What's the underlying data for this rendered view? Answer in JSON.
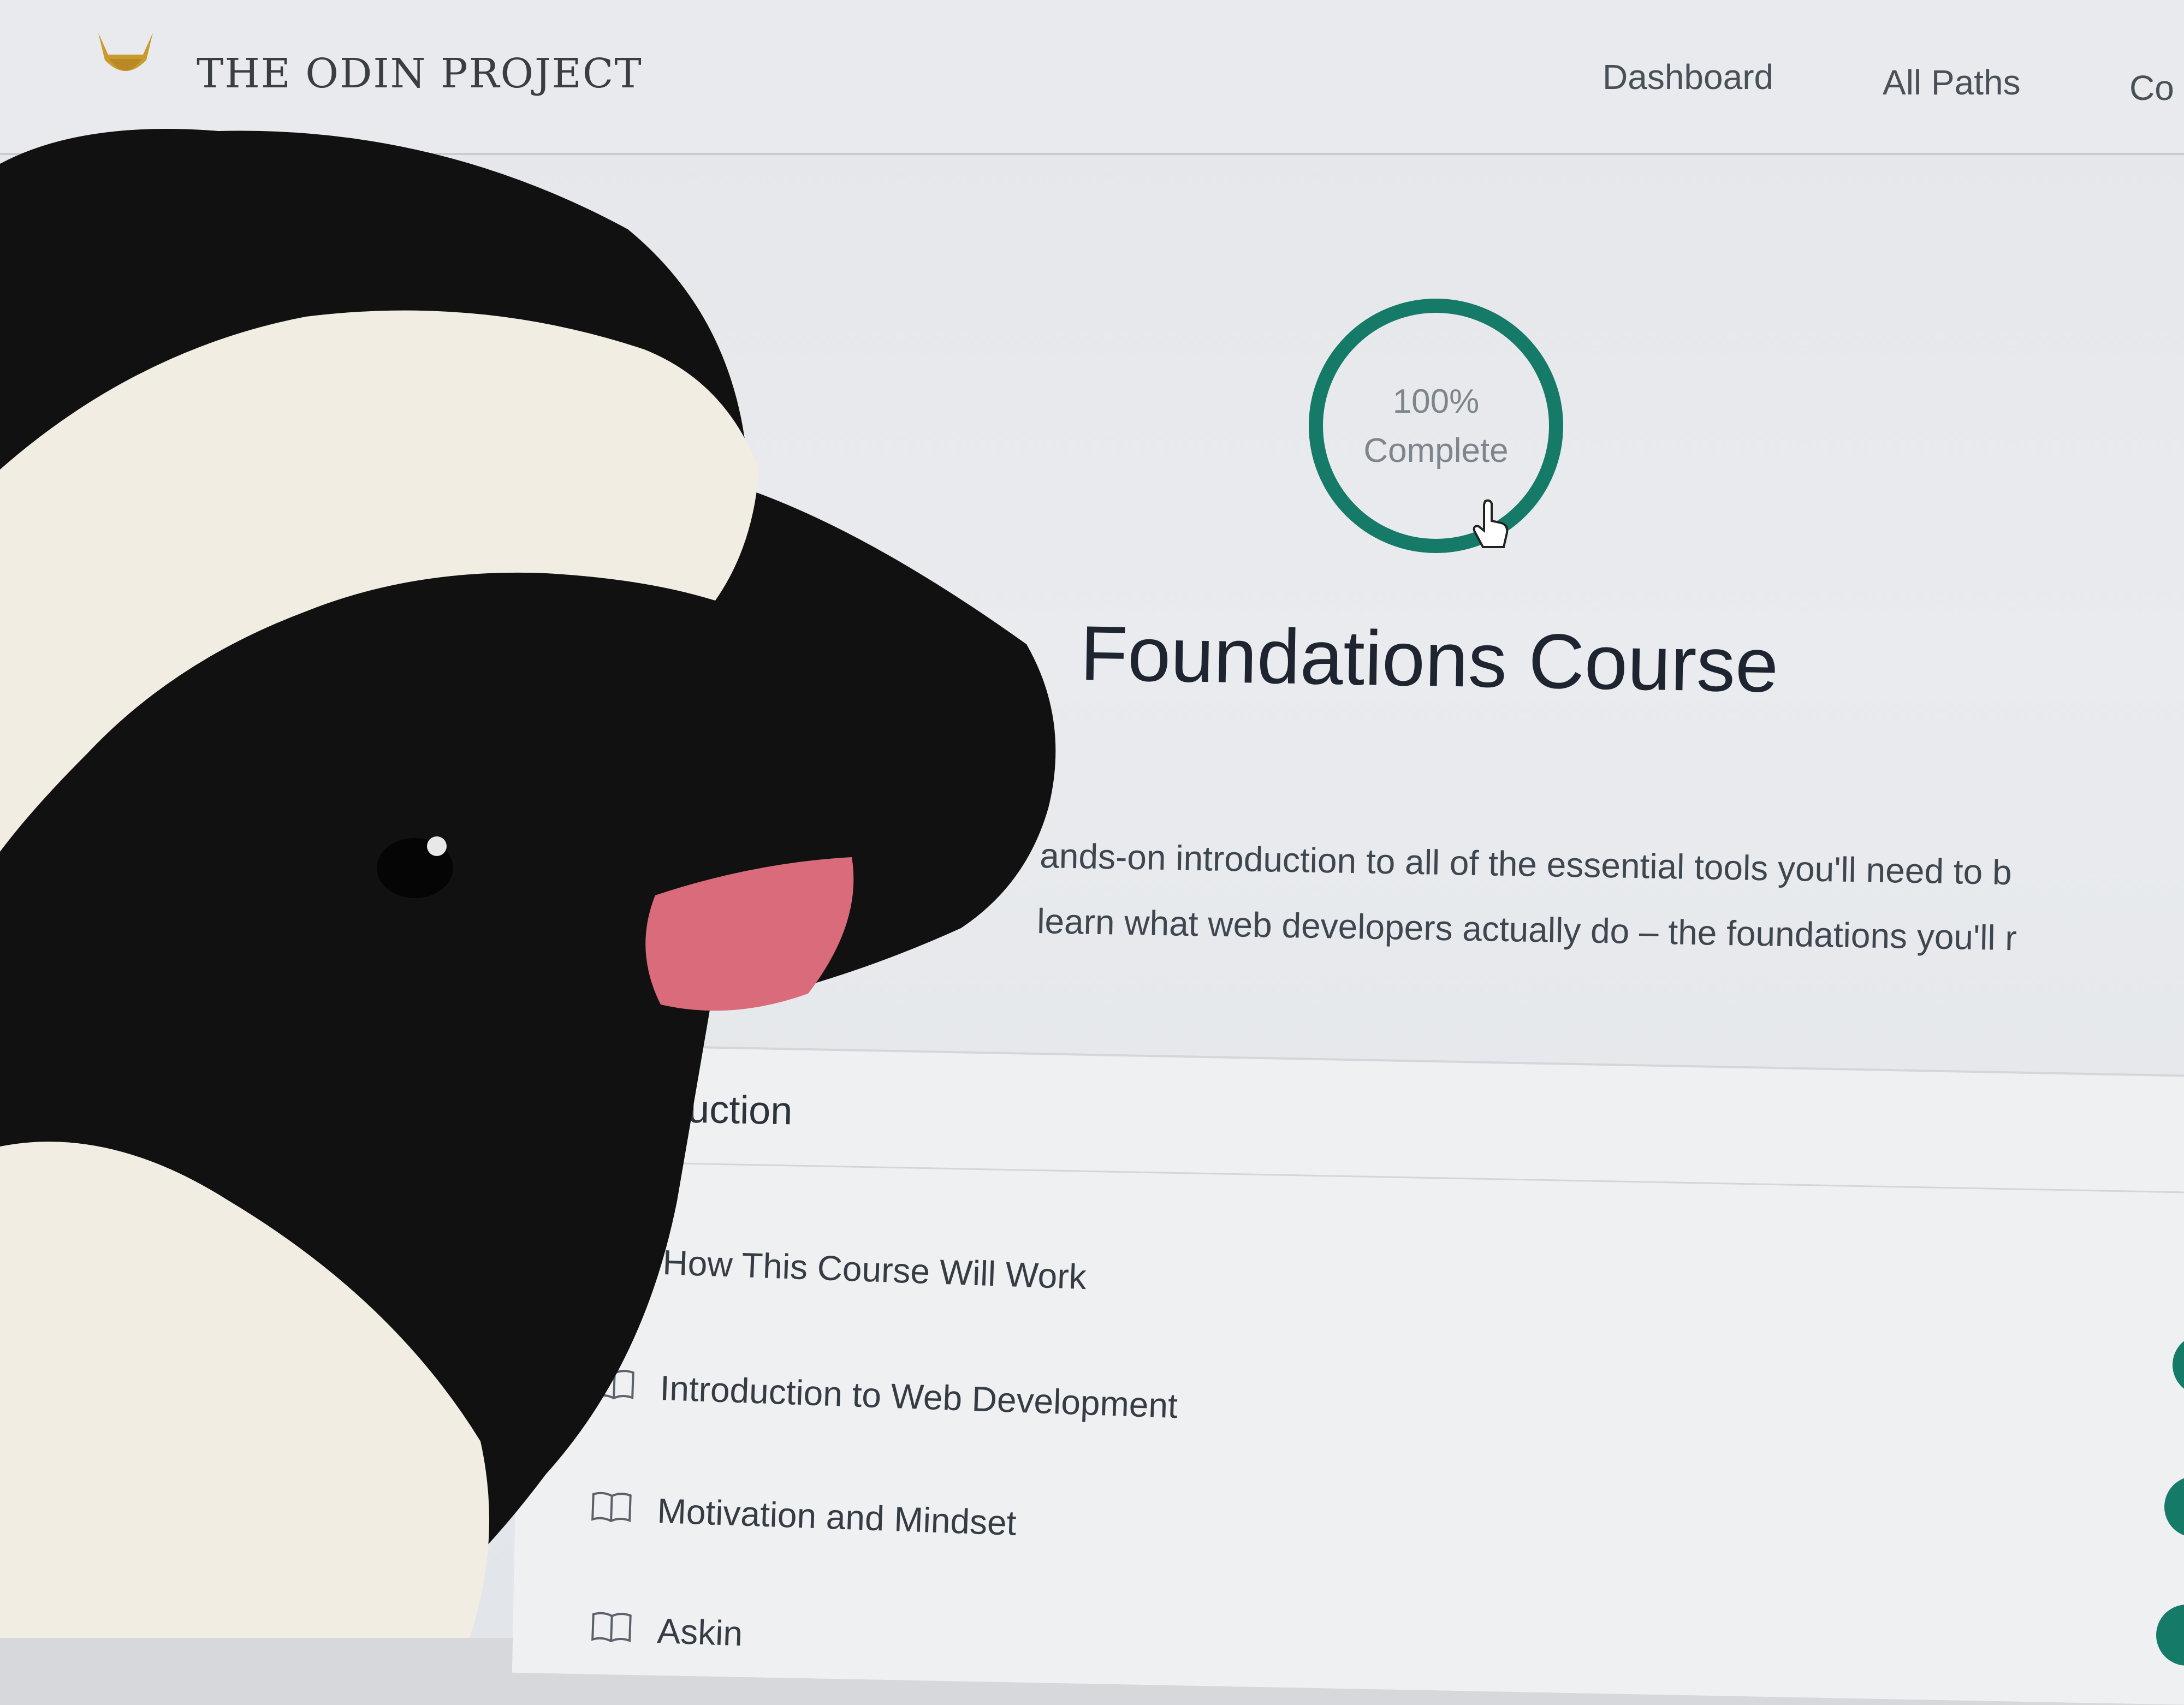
{
  "brand": {
    "name": "THE ODIN PROJECT",
    "logo_icon": "viking-helmet-icon",
    "accent": "#c99a2e"
  },
  "nav": {
    "items": [
      "Dashboard",
      "All Paths",
      "Co"
    ]
  },
  "progress": {
    "percent_text": "100%",
    "status": "Complete",
    "value": 1.0,
    "ring_color": "#157a68"
  },
  "course": {
    "title": "Foundations Course",
    "description_lines": [
      "ands-on introduction to all of the essential tools you'll need to b",
      "learn what web developers actually do – the foundations you'll r"
    ]
  },
  "section": {
    "heading": "duction",
    "lessons": [
      {
        "title": "How This Course Will Work",
        "icon": "book-icon"
      },
      {
        "title": "Introduction to Web Development",
        "icon": "book-icon"
      },
      {
        "title": "Motivation and Mindset",
        "icon": "book-icon"
      },
      {
        "title": "Askin",
        "icon": "book-icon"
      }
    ],
    "completion_icon": "check-circle-icon",
    "completion_color": "#157a68"
  },
  "foreground": {
    "object": "plush-penguin",
    "colors": [
      "#111111",
      "#f1ede2",
      "#d96b7b"
    ]
  }
}
